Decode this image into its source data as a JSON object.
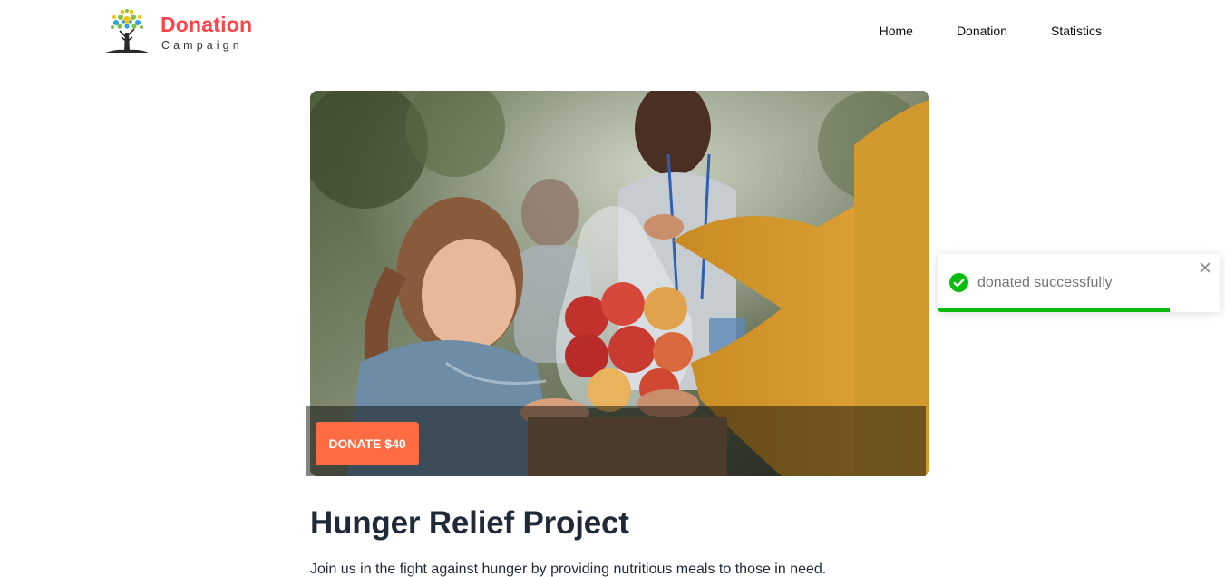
{
  "brand": {
    "title": "Donation",
    "subtitle": "Campaign",
    "logo_icon": "tree-icon",
    "color": "#ff444a"
  },
  "nav": {
    "items": [
      {
        "label": "Home"
      },
      {
        "label": "Donation"
      },
      {
        "label": "Statistics"
      }
    ]
  },
  "hero": {
    "image": "volunteers-giving-apples-photo",
    "donate_label": "DONATE $40",
    "button_color": "#ff6b43"
  },
  "details": {
    "title": "Hunger Relief Project",
    "description": "Join us in the fight against hunger by providing nutritious meals to those in need."
  },
  "toast": {
    "message": "donated successfully",
    "icon": "check-circle-icon",
    "close_icon": "close-icon",
    "progress": 0.82,
    "color": "#07bc0c"
  }
}
